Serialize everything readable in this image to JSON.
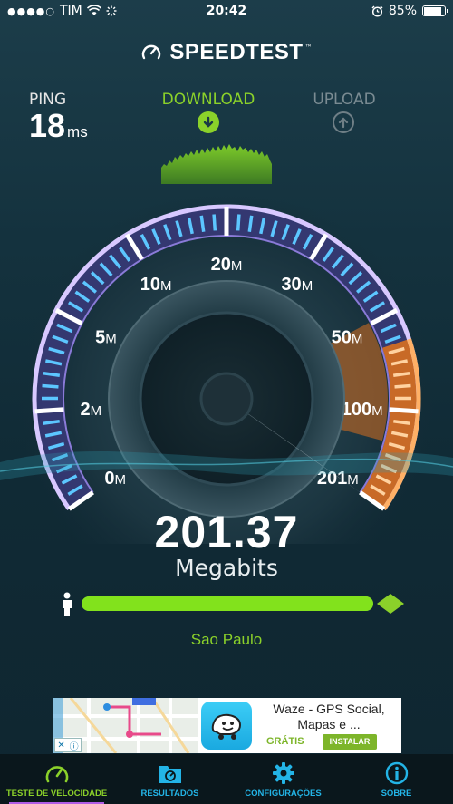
{
  "status_bar": {
    "signal_dots": "●●●●○",
    "carrier": "TIM",
    "time": "20:42",
    "battery_percent": "85%"
  },
  "app": {
    "logo_text": "SPEEDTEST"
  },
  "stats": {
    "ping_label": "PING",
    "ping_value": "18",
    "ping_unit": "ms",
    "download_label": "DOWNLOAD",
    "upload_label": "UPLOAD"
  },
  "gauge": {
    "ticks": [
      "0M",
      "2M",
      "5M",
      "10M",
      "20M",
      "30M",
      "50M",
      "100M",
      "201M"
    ],
    "needle_value_mbps": 201.37
  },
  "result": {
    "speed": "201.37",
    "unit": "Megabits",
    "progress": 1.0,
    "server": "Sao Paulo"
  },
  "ad": {
    "title": "Waze - GPS Social, Mapas e ...",
    "free_label": "GRÁTIS",
    "install_label": "INSTALAR"
  },
  "tabs": [
    {
      "label": "TESTE DE VELOCIDADE",
      "icon": "speedometer-icon",
      "active": true
    },
    {
      "label": "RESULTADOS",
      "icon": "folder-icon",
      "active": false
    },
    {
      "label": "CONFIGURAÇÕES",
      "icon": "gear-icon",
      "active": false
    },
    {
      "label": "SOBRE",
      "icon": "info-icon",
      "active": false
    }
  ],
  "colors": {
    "accent_green": "#8bd12a",
    "accent_blue": "#23b4e6",
    "gauge_orange": "#f08a2c",
    "gauge_purple": "#a06ee8"
  }
}
